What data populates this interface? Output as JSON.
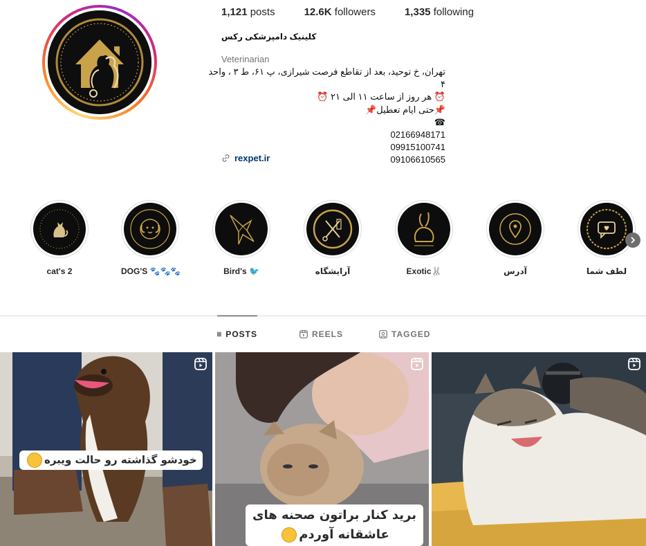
{
  "profile": {
    "posts_count": "1,121",
    "posts_label": "posts",
    "followers_count": "12.6K",
    "followers_label": "followers",
    "following_count": "1,335",
    "following_label": "following",
    "full_name": "کلینیک دامپزشکی رکس",
    "category": "Veterinarian",
    "bio_lines": [
      "تهران، خ توحید، بعد از تقاطع فرصت شیرازی، پ ۶۱، ط ۳ ، واحد ۴",
      "⏰ هر روز از ساعت ۱۱ الی ۲۱ ⏰",
      "📌حتی ایام تعطیل📌",
      "☎",
      "02166948171",
      "09915100741",
      "09106610565"
    ],
    "link": "rexpet.ir"
  },
  "highlights": [
    {
      "label": "cat's 2",
      "icon": "cat-icon"
    },
    {
      "label": "DOG'S 🐾🐾🐾",
      "icon": "dog-icon"
    },
    {
      "label": "Bird's 🐦",
      "icon": "bird-icon"
    },
    {
      "label": "آرایشگاه",
      "icon": "scissors-comb-icon"
    },
    {
      "label": "Exotic🐰",
      "icon": "rabbit-icon"
    },
    {
      "label": "آدرس",
      "icon": "location-pin-icon"
    },
    {
      "label": "لطف شما",
      "icon": "chat-heart-icon"
    }
  ],
  "tabs": [
    {
      "label": "POSTS",
      "icon": "grid-icon",
      "active": true
    },
    {
      "label": "REELS",
      "icon": "reels-icon",
      "active": false
    },
    {
      "label": "TAGGED",
      "icon": "tagged-icon",
      "active": false
    }
  ],
  "posts": [
    {
      "caption": "خودشو گذاشته رو حالت ویبره",
      "type": "reel"
    },
    {
      "caption_line1": "برید کنار براتون صحنه های",
      "caption_line2": "عاشقانه آوردم",
      "type": "reel"
    },
    {
      "caption": "",
      "type": "reel"
    }
  ],
  "colors": {
    "gold": "#c9a24a",
    "link": "#00376b",
    "text": "#262626",
    "muted": "#737373"
  }
}
